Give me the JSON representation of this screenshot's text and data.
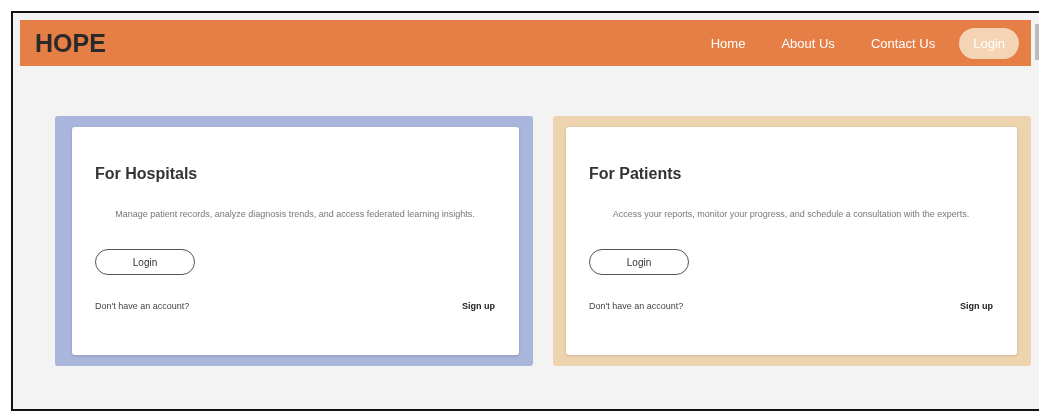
{
  "header": {
    "logo": "HOPE",
    "nav": [
      {
        "label": "Home",
        "kind": "link"
      },
      {
        "label": "About Us",
        "kind": "link"
      },
      {
        "label": "Contact Us",
        "kind": "link"
      },
      {
        "label": "Login",
        "kind": "button"
      }
    ]
  },
  "cards": [
    {
      "title": "For Hospitals",
      "description": "Manage patient records, analyze diagnosis trends, and access federated learning insights.",
      "button": "Login",
      "prompt": "Don't have an account?",
      "link": "Sign up",
      "color": "#aab5dc"
    },
    {
      "title": "For Patients",
      "description": "Access your reports, monitor your progress, and schedule a consultation with the experts.",
      "button": "Login",
      "prompt": "Don't have an account?",
      "link": "Sign up",
      "color": "#eed3af"
    }
  ]
}
